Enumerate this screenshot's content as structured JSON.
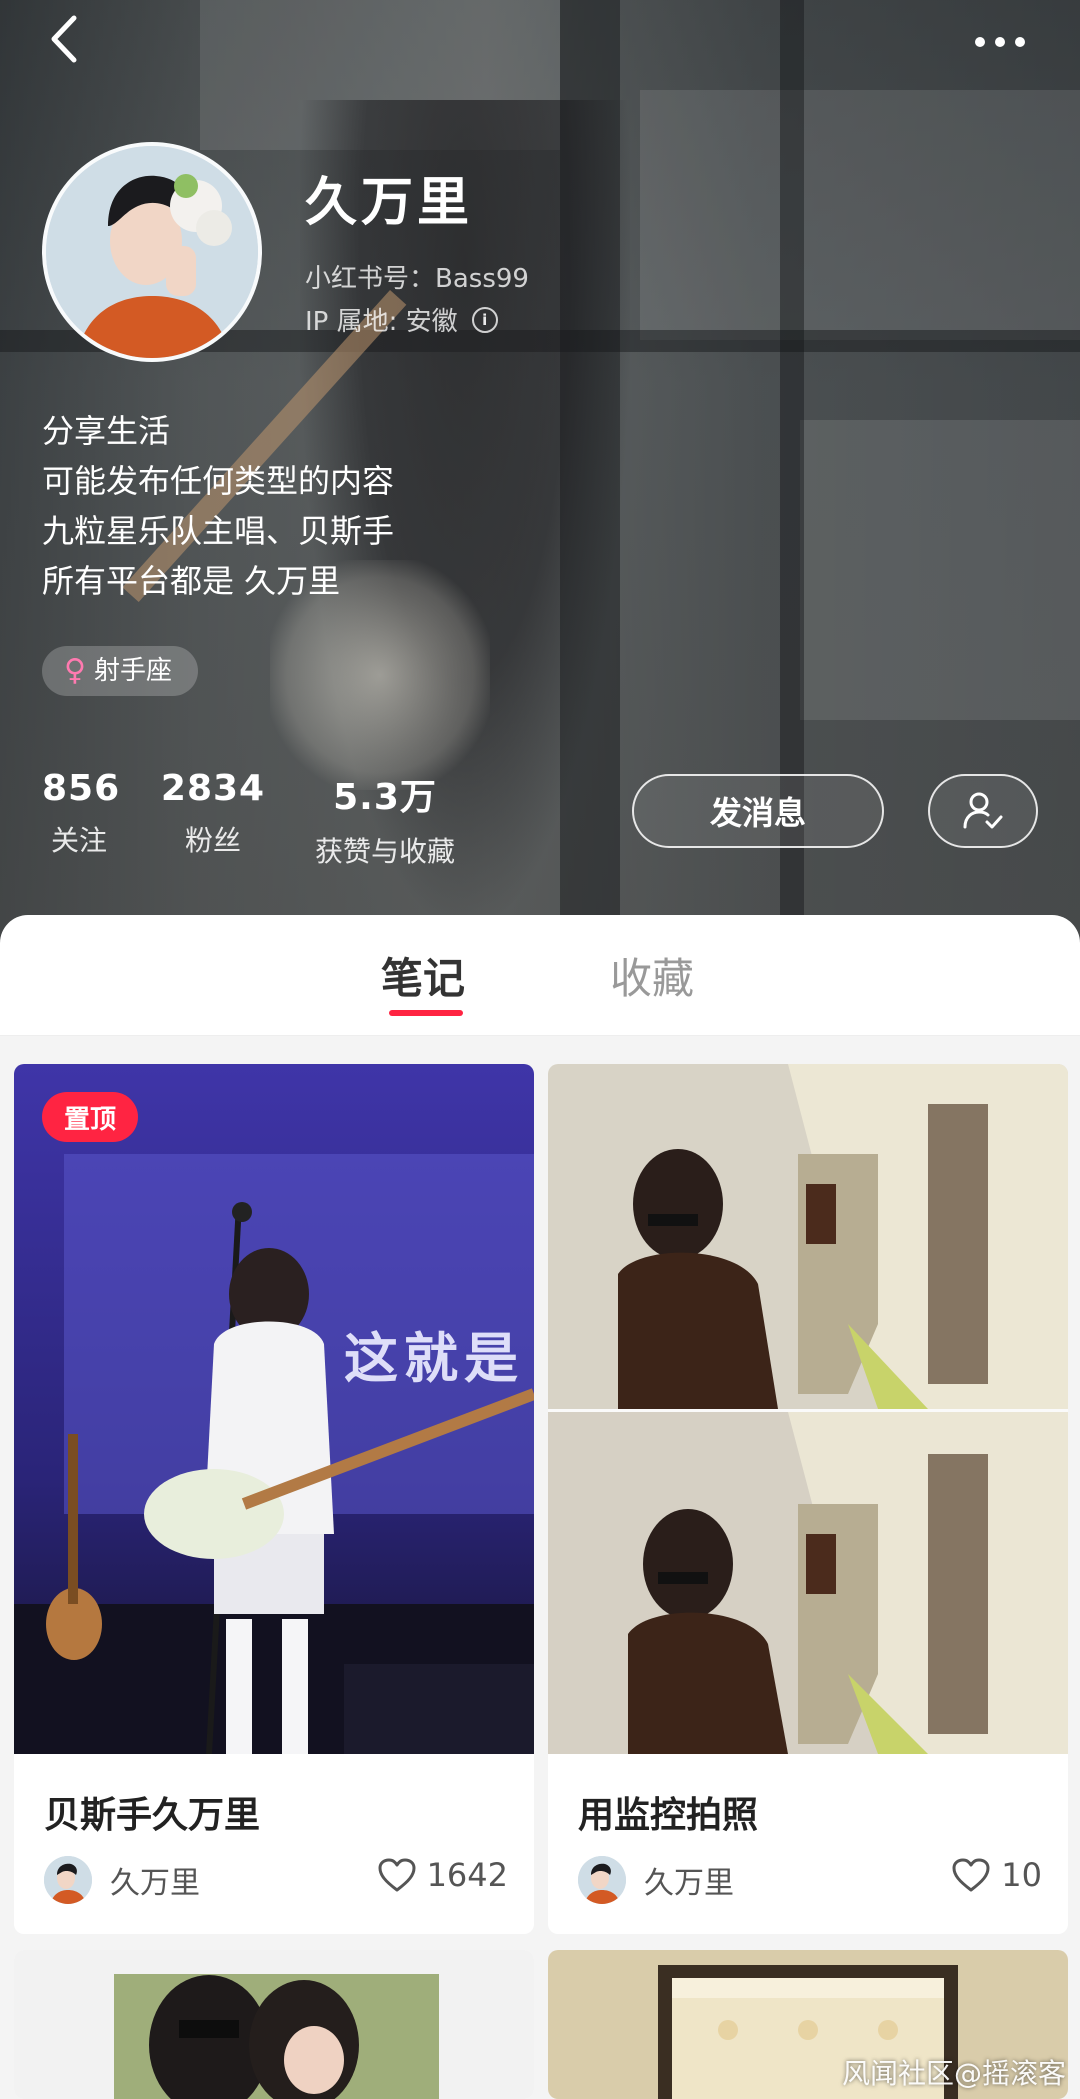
{
  "header": {
    "nickname": "久万里",
    "redbook_id": "小红书号：Bass99",
    "ip_location": "IP 属地: 安徽",
    "bio_lines": [
      "分享生活",
      "可能发布任何类型的内容",
      "九粒星乐队主唱、贝斯手",
      "所有平台都是 久万里"
    ],
    "tag": "射手座",
    "stats": [
      {
        "value": "856",
        "label": "关注"
      },
      {
        "value": "2834",
        "label": "粉丝"
      },
      {
        "value": "5.3万",
        "label": "获赞与收藏"
      }
    ],
    "message_button": "发消息"
  },
  "tabs": [
    {
      "label": "笔记",
      "active": true
    },
    {
      "label": "收藏",
      "active": false
    }
  ],
  "notes": [
    {
      "title": "贝斯手久万里",
      "author": "久万里",
      "likes": "1642",
      "pinned_label": "置顶",
      "cover_text": "这就是"
    },
    {
      "title": "用监控拍照",
      "author": "久万里",
      "likes": "10"
    }
  ],
  "watermark": "风闻社区@摇滚客",
  "colors": {
    "accent": "#ff2442",
    "tab_inactive": "#999999"
  }
}
